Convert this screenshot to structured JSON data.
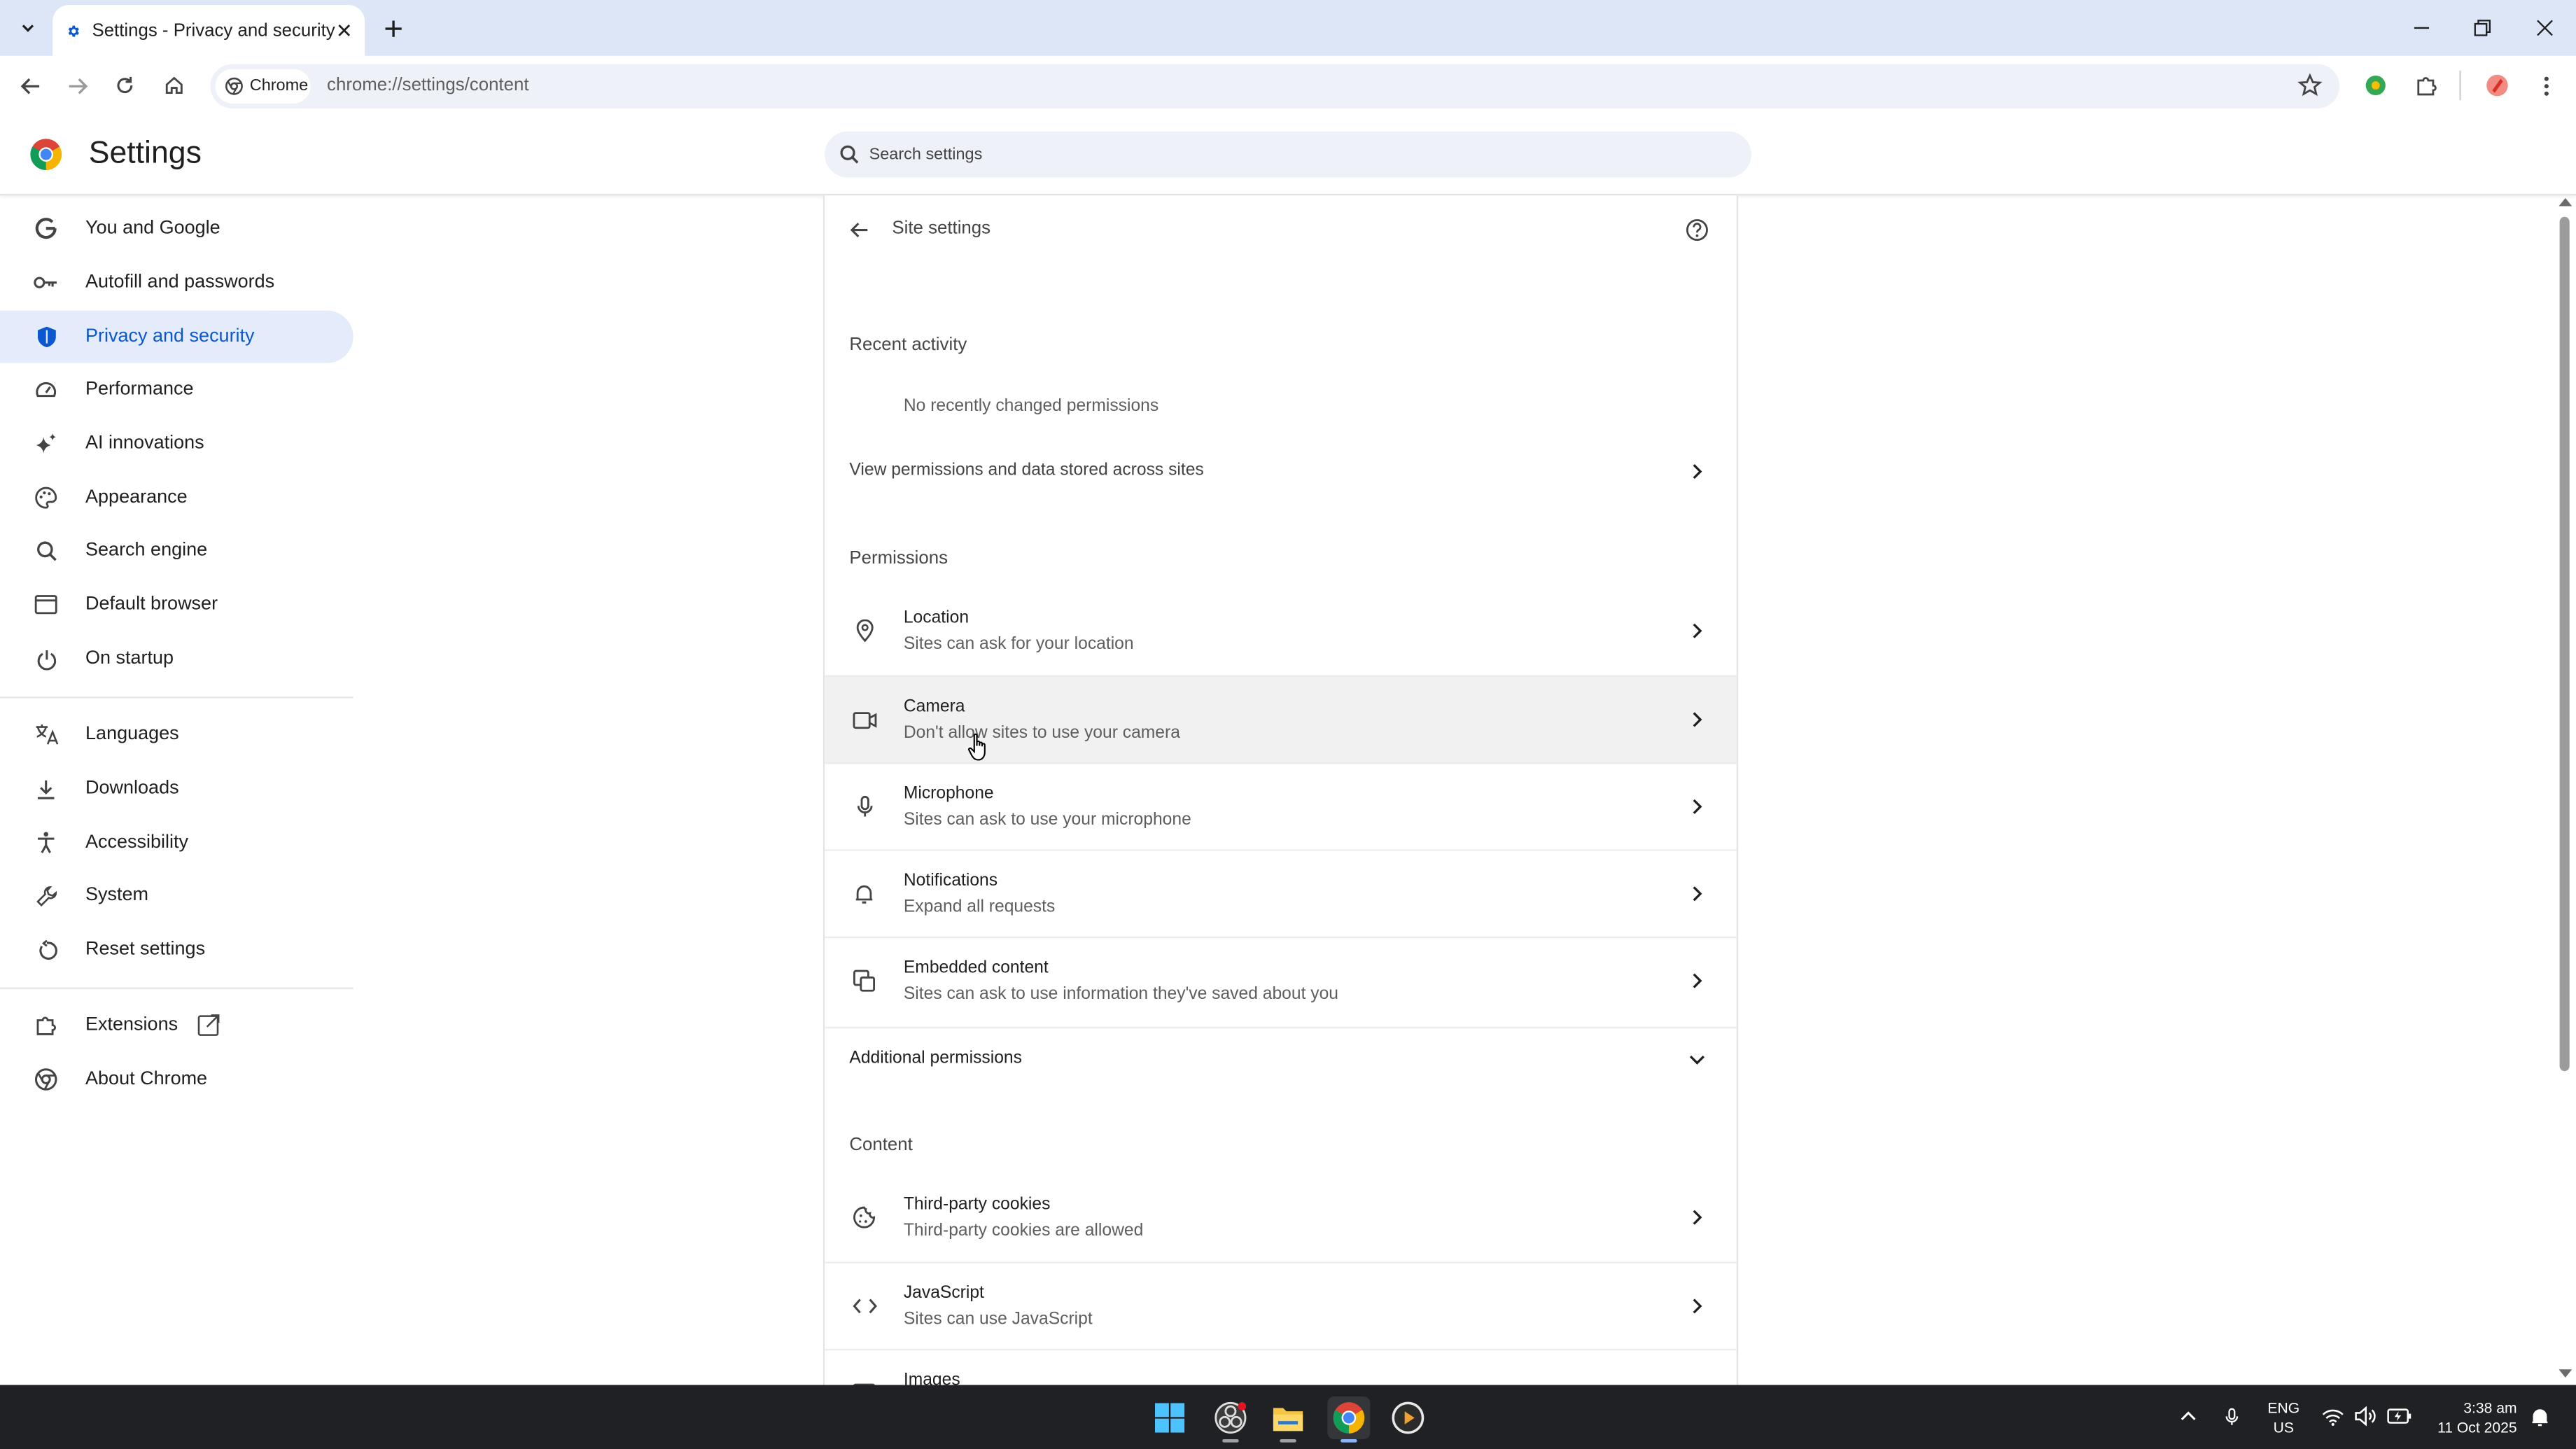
{
  "browser": {
    "tab_title": "Settings - Privacy and security",
    "chip_label": "Chrome",
    "url": "chrome://settings/content"
  },
  "settings": {
    "title": "Settings",
    "search_placeholder": "Search settings"
  },
  "sidebar": {
    "items": [
      {
        "label": "You and Google",
        "icon": "google-g-icon"
      },
      {
        "label": "Autofill and passwords",
        "icon": "key-icon"
      },
      {
        "label": "Privacy and security",
        "icon": "shield-icon",
        "active": true
      },
      {
        "label": "Performance",
        "icon": "speedometer-icon"
      },
      {
        "label": "AI innovations",
        "icon": "sparkle-icon"
      },
      {
        "label": "Appearance",
        "icon": "palette-icon"
      },
      {
        "label": "Search engine",
        "icon": "search-icon"
      },
      {
        "label": "Default browser",
        "icon": "browser-window-icon"
      },
      {
        "label": "On startup",
        "icon": "power-icon"
      },
      {
        "label": "Languages",
        "icon": "translate-icon"
      },
      {
        "label": "Downloads",
        "icon": "download-icon"
      },
      {
        "label": "Accessibility",
        "icon": "accessibility-icon"
      },
      {
        "label": "System",
        "icon": "wrench-icon"
      },
      {
        "label": "Reset settings",
        "icon": "reset-icon"
      },
      {
        "label": "Extensions",
        "icon": "puzzle-icon"
      },
      {
        "label": "About Chrome",
        "icon": "chrome-icon"
      }
    ]
  },
  "site_settings": {
    "title": "Site settings",
    "recent_activity_title": "Recent activity",
    "recent_activity_empty": "No recently changed permissions",
    "view_permissions_label": "View permissions and data stored across sites",
    "permissions_title": "Permissions",
    "permissions": [
      {
        "title": "Location",
        "subtitle": "Sites can ask for your location"
      },
      {
        "title": "Camera",
        "subtitle": "Don't allow sites to use your camera"
      },
      {
        "title": "Microphone",
        "subtitle": "Sites can ask to use your microphone"
      },
      {
        "title": "Notifications",
        "subtitle": "Expand all requests"
      },
      {
        "title": "Embedded content",
        "subtitle": "Sites can ask to use information they've saved about you"
      }
    ],
    "additional_permissions_label": "Additional permissions",
    "content_title": "Content",
    "content": [
      {
        "title": "Third-party cookies",
        "subtitle": "Third-party cookies are allowed"
      },
      {
        "title": "JavaScript",
        "subtitle": "Sites can use JavaScript"
      },
      {
        "title": "Images",
        "subtitle": ""
      }
    ]
  },
  "taskbar": {
    "lang_line1": "ENG",
    "lang_line2": "US",
    "time": "3:38 am",
    "date": "11 Oct 2025"
  },
  "colors": {
    "accent": "#0b57d0",
    "active_nav_bg": "#e4ecfb",
    "tabstrip_bg": "#dce6f6",
    "taskbar_bg": "#202124"
  }
}
